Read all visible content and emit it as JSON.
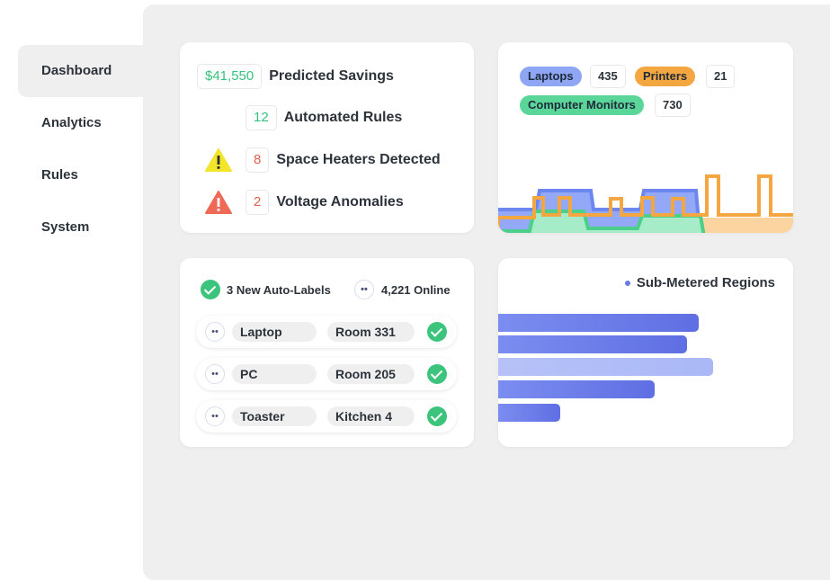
{
  "sidebar": {
    "items": [
      {
        "label": "Dashboard",
        "active": true
      },
      {
        "label": "Analytics",
        "active": false
      },
      {
        "label": "Rules",
        "active": false
      },
      {
        "label": "System",
        "active": false
      }
    ]
  },
  "stats": {
    "savings": {
      "value": "$41,550",
      "label": "Predicted Savings"
    },
    "rules": {
      "value": "12",
      "label": "Automated Rules"
    },
    "heaters": {
      "value": "8",
      "label": "Space Heaters Detected",
      "icon": "warning-yellow-icon"
    },
    "voltage": {
      "value": "2",
      "label": "Voltage Anomalies",
      "icon": "warning-red-icon"
    }
  },
  "device_chart": {
    "tags": [
      {
        "label": "Laptops",
        "count": "435",
        "color": "#8fa6f5"
      },
      {
        "label": "Printers",
        "count": "21",
        "color": "#f4a640"
      },
      {
        "label": "Computer Monitors",
        "count": "730",
        "color": "#5bd699"
      }
    ]
  },
  "labels_card": {
    "auto_labels": "3 New Auto-Labels",
    "online": "4,221 Online",
    "devices": [
      {
        "device": "Laptop",
        "location": "Room 331"
      },
      {
        "device": "PC",
        "location": "Room 205"
      },
      {
        "device": "Toaster",
        "location": "Kitchen 4"
      }
    ]
  },
  "regions_card": {
    "legend": "Sub-Metered Regions",
    "values": [
      0.68,
      0.64,
      0.73,
      0.53,
      0.21
    ]
  },
  "colors": {
    "green": "#3cc47c",
    "red": "#e0604e",
    "blue_series": "#8fa6f5",
    "orange_series": "#f4a640",
    "teal_series": "#5bd699",
    "bar": "#6b7be6"
  }
}
